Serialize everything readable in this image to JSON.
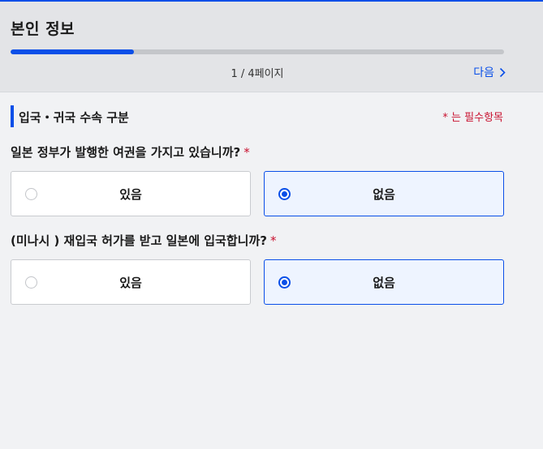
{
  "header": {
    "title": "본인 정보",
    "progress_fraction": 0.25,
    "page_indicator": "1 / 4페이지",
    "next_label": "다음"
  },
  "section": {
    "title": "입국・귀국 수속 구분",
    "required_note": "* 는 필수항목"
  },
  "questions": [
    {
      "text": "일본 정부가 발행한 여권을 가지고 있습니까?",
      "required_mark": "*",
      "options": [
        {
          "label": "있음",
          "selected": false
        },
        {
          "label": "없음",
          "selected": true
        }
      ]
    },
    {
      "text": "(미나시 ) 재입국 허가를 받고 일본에 입국합니까?",
      "required_mark": "*",
      "options": [
        {
          "label": "있음",
          "selected": false
        },
        {
          "label": "없음",
          "selected": true
        }
      ]
    }
  ],
  "colors": {
    "accent": "#0a4fe8",
    "required": "#c8102e",
    "header_bg": "#e3e4e7",
    "page_bg": "#f1f2f4"
  },
  "icons": {
    "next": "chevron-right-icon"
  }
}
